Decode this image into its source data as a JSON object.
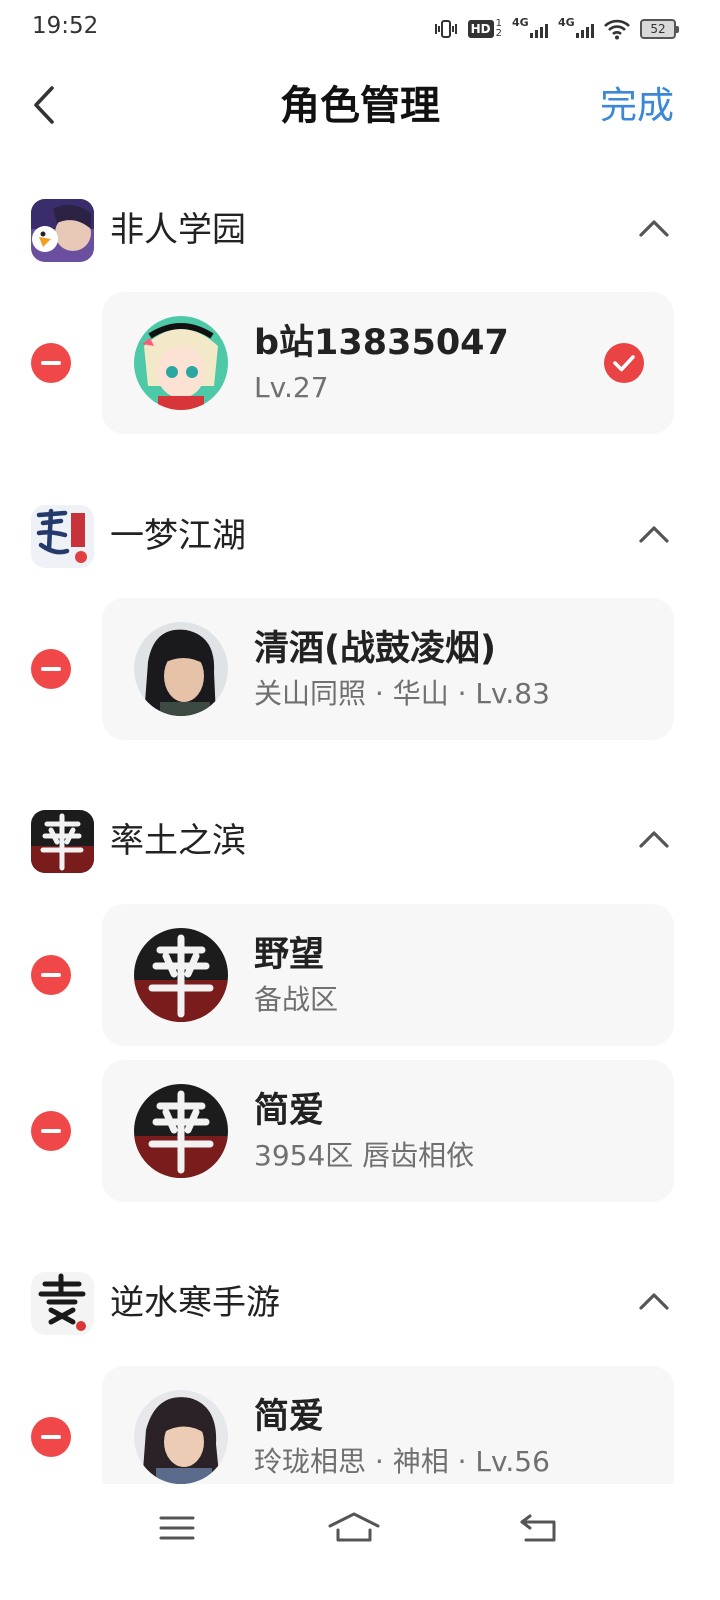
{
  "status_bar": {
    "time": "19:52",
    "icons": [
      "vibrate-icon",
      "hd-voice-icon",
      "signal-4g-icon",
      "signal-4g-icon",
      "wifi-icon",
      "battery-icon"
    ],
    "hd_label": "HD",
    "hd_sub_top": "1",
    "hd_sub_bottom": "2",
    "signal_label_1": "4G",
    "signal_label_2": "4G",
    "battery_level": "52"
  },
  "header": {
    "back_icon": "chevron-left-icon",
    "title": "角色管理",
    "done_label": "完成"
  },
  "colors": {
    "accent": "#3d87d9",
    "remove": "#f04848",
    "selected": "#e94343",
    "card_bg": "#f7f7f7"
  },
  "groups": [
    {
      "name": "非人学园",
      "roles": [
        {
          "name": "b站13835047",
          "sub": "Lv.27",
          "selected": true
        }
      ]
    },
    {
      "name": "一梦江湖",
      "roles": [
        {
          "name": "清酒(战鼓凌烟)",
          "sub": "关山同照 · 华山 · Lv.83",
          "selected": false
        }
      ]
    },
    {
      "name": "率土之滨",
      "roles": [
        {
          "name": "野望",
          "sub": "备战区",
          "selected": false
        },
        {
          "name": "简爱",
          "sub": "3954区 唇齿相依",
          "selected": false
        }
      ]
    },
    {
      "name": "逆水寒手游",
      "roles": [
        {
          "name": "简爱",
          "sub": "玲珑相思 · 神相 · Lv.56",
          "selected": false
        }
      ]
    }
  ],
  "nav_bar": {
    "menu_icon": "menu-icon",
    "home_icon": "home-icon",
    "back_icon": "back-icon"
  }
}
